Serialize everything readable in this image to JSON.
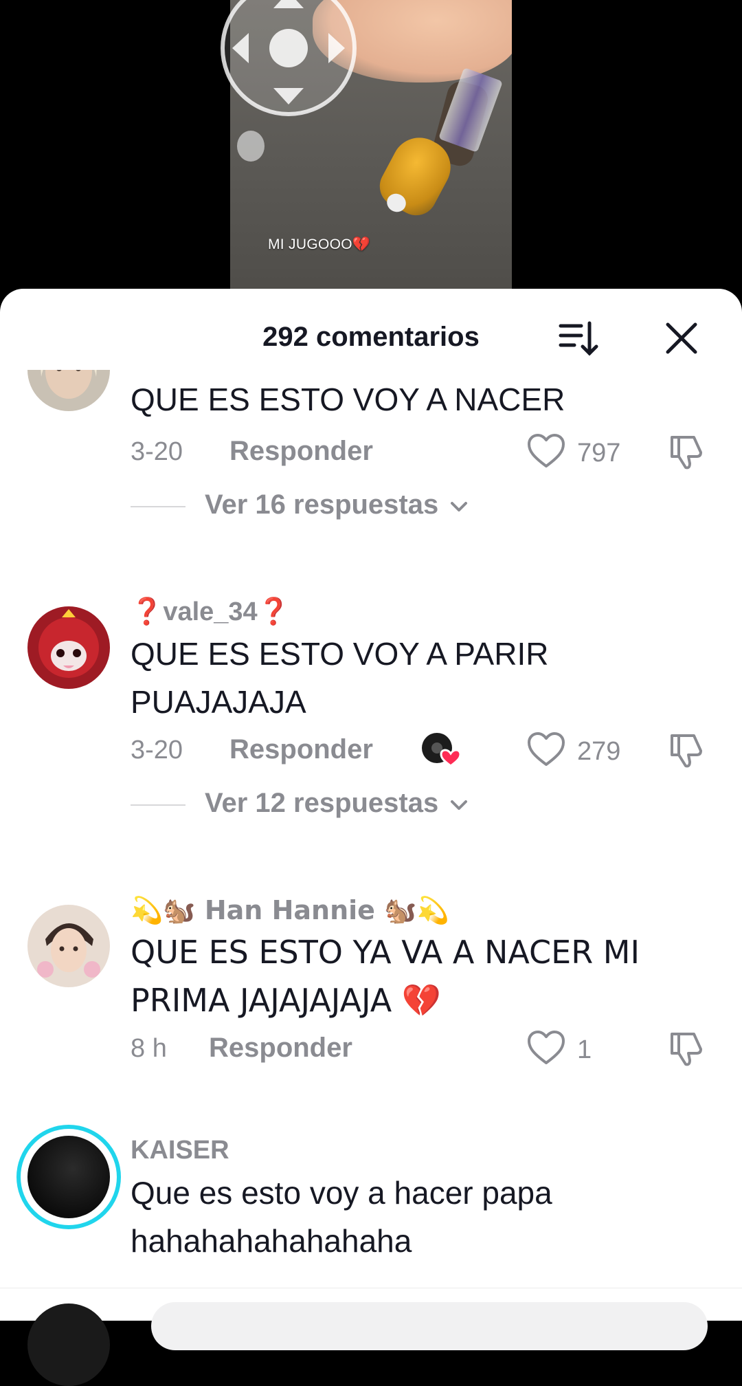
{
  "video": {
    "caption": "MI JUGOOO💔"
  },
  "sheet": {
    "comment_count": "292 comentarios"
  },
  "comments": [
    {
      "username": "",
      "text": "QUE ES ESTO VOY A NACER",
      "date": "3-20",
      "reply_label": "Responder",
      "likes": "797",
      "view_replies": "Ver 16 respuestas"
    },
    {
      "username": "❓vale_34❓",
      "text": "QUE ES ESTO VOY A PARIR PUAJAJAJA",
      "date": "3-20",
      "reply_label": "Responder",
      "likes": "279",
      "view_replies": "Ver 12 respuestas",
      "creator_liked": true
    },
    {
      "username": "💫🐿️ Han Hannie 🐿️💫",
      "text": "QUE ES ESTO YA VA A NACER MI PRIMA JAJAJAJAJA 💔",
      "date": "8 h",
      "reply_label": "Responder",
      "likes": "1"
    },
    {
      "username": "KAISER",
      "text": "Que es esto voy a hacer papa hahahahahahahaha"
    }
  ],
  "icons": {
    "dpad": "dpad-icon",
    "sort": "sort-icon",
    "close": "close-icon",
    "heart": "heart-icon",
    "dislike": "dislike-icon",
    "chevron": "chevron-down-icon"
  },
  "colors": {
    "text_primary": "#161823",
    "text_secondary": "#8a8b91",
    "story_ring": "#20d5ec",
    "broken_heart": "#fe2c55"
  }
}
